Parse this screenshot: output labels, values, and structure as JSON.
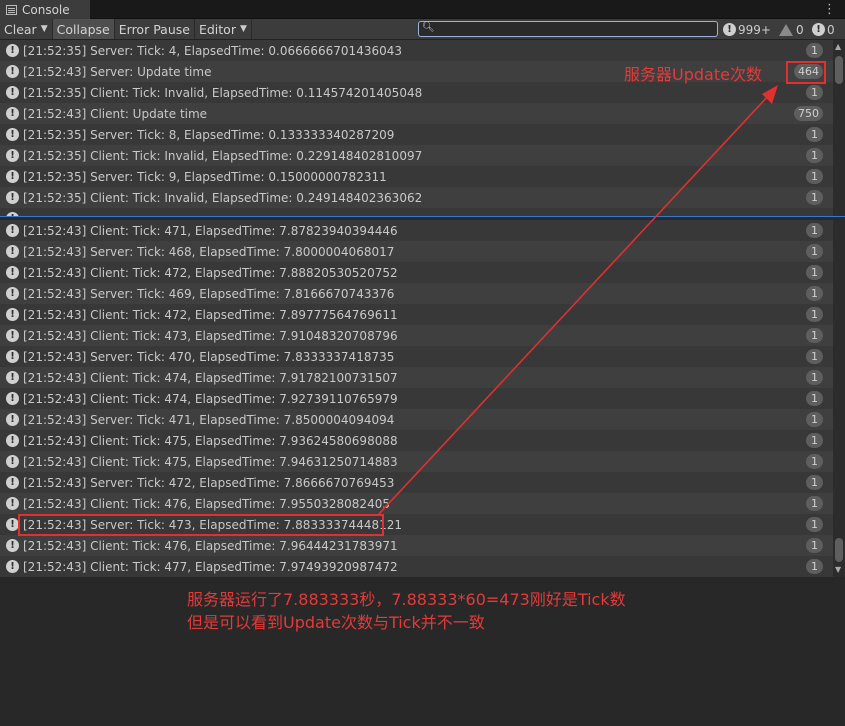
{
  "tab": {
    "title": "Console"
  },
  "toolbar": {
    "clear": "Clear",
    "collapse": "Collapse",
    "error_pause": "Error Pause",
    "editor": "Editor",
    "search_placeholder": "",
    "info_count": "999+",
    "warn_count": "0",
    "error_count": "0"
  },
  "upper_logs": [
    {
      "text": "[21:52:35] Server: Tick: 4, ElapsedTime: 0.0666666701436043",
      "count": "1"
    },
    {
      "text": "[21:52:43] Server: Update time",
      "count": "464"
    },
    {
      "text": "[21:52:35] Client: Tick: Invalid, ElapsedTime: 0.114574201405048",
      "count": "1"
    },
    {
      "text": "[21:52:43] Client: Update time",
      "count": "750"
    },
    {
      "text": "[21:52:35] Server: Tick: 8, ElapsedTime: 0.133333340287209",
      "count": "1"
    },
    {
      "text": "[21:52:35] Client: Tick: Invalid, ElapsedTime: 0.229148402810097",
      "count": "1"
    },
    {
      "text": "[21:52:35] Server: Tick: 9, ElapsedTime: 0.15000000782311",
      "count": "1"
    },
    {
      "text": "[21:52:35] Client: Tick: Invalid, ElapsedTime: 0.249148402363062",
      "count": "1"
    }
  ],
  "lower_logs": [
    {
      "text": "[21:52:43] Client: Tick: 471, ElapsedTime: 7.87823940394446",
      "count": "1"
    },
    {
      "text": "[21:52:43] Server: Tick: 468, ElapsedTime: 7.8000004068017",
      "count": "1"
    },
    {
      "text": "[21:52:43] Client: Tick: 472, ElapsedTime: 7.88820530520752",
      "count": "1"
    },
    {
      "text": "[21:52:43] Server: Tick: 469, ElapsedTime: 7.8166670743376",
      "count": "1"
    },
    {
      "text": "[21:52:43] Client: Tick: 472, ElapsedTime: 7.89777564769611",
      "count": "1"
    },
    {
      "text": "[21:52:43] Client: Tick: 473, ElapsedTime: 7.91048320708796",
      "count": "1"
    },
    {
      "text": "[21:52:43] Server: Tick: 470, ElapsedTime: 7.8333337418735",
      "count": "1"
    },
    {
      "text": "[21:52:43] Client: Tick: 474, ElapsedTime: 7.91782100731507",
      "count": "1"
    },
    {
      "text": "[21:52:43] Client: Tick: 474, ElapsedTime: 7.92739110765979",
      "count": "1"
    },
    {
      "text": "[21:52:43] Server: Tick: 471, ElapsedTime: 7.8500004094094",
      "count": "1"
    },
    {
      "text": "[21:52:43] Client: Tick: 475, ElapsedTime: 7.93624580698088",
      "count": "1"
    },
    {
      "text": "[21:52:43] Client: Tick: 475, ElapsedTime: 7.94631250714883",
      "count": "1"
    },
    {
      "text": "[21:52:43] Server: Tick: 472, ElapsedTime: 7.8666670769453",
      "count": "1"
    },
    {
      "text": "[21:52:43] Client: Tick: 476, ElapsedTime: 7.9550328082405",
      "count": "1"
    },
    {
      "text": "[21:52:43] Server: Tick: 473, ElapsedTime: 7.88333374448121",
      "count": "1"
    },
    {
      "text": "[21:52:43] Client: Tick: 476, ElapsedTime: 7.96444231783971",
      "count": "1"
    },
    {
      "text": "[21:52:43] Client: Tick: 477, ElapsedTime: 7.97493920987472",
      "count": "1"
    }
  ],
  "annotations": {
    "update_count_note": "服务器Update次数",
    "explain_line1": "服务器运行了7.883333秒，7.88333*60=473刚好是Tick数",
    "explain_line2": "但是可以看到Update次数与Tick并不一致",
    "color": "#e03030"
  },
  "icons": {
    "row": "info-icon",
    "tab": "console-icon",
    "search": "search-icon",
    "warn": "warning-icon",
    "error": "error-icon",
    "menu": "kebab-menu-icon"
  }
}
